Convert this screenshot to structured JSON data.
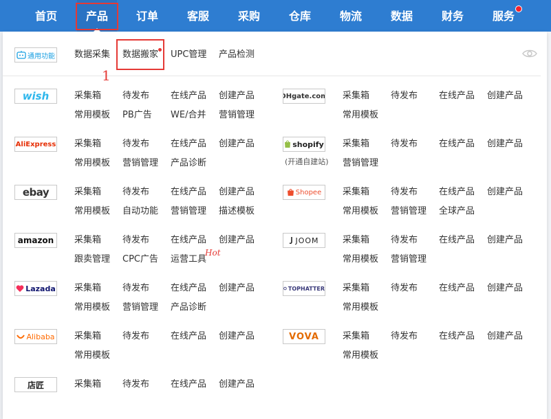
{
  "nav": {
    "items": [
      {
        "label": "首页"
      },
      {
        "label": "产品"
      },
      {
        "label": "订单"
      },
      {
        "label": "客服"
      },
      {
        "label": "采购"
      },
      {
        "label": "仓库"
      },
      {
        "label": "物流"
      },
      {
        "label": "数据"
      },
      {
        "label": "财务"
      },
      {
        "label": "服务"
      }
    ],
    "active": "产品"
  },
  "general": {
    "logo_text": "通用功能",
    "links": [
      "数据采集",
      "数据搬家",
      "UPC管理",
      "产品检测"
    ]
  },
  "annotation": {
    "number": "1"
  },
  "platforms": {
    "wish": {
      "name": "wish",
      "links": [
        "采集箱",
        "待发布",
        "在线产品",
        "创建产品",
        "常用模板",
        "PB广告",
        "WE/合并",
        "营销管理"
      ]
    },
    "dhgate": {
      "name": "DHgate.com",
      "links": [
        "采集箱",
        "待发布",
        "在线产品",
        "创建产品",
        "常用模板"
      ]
    },
    "aliexpress": {
      "name": "AliExpress",
      "links": [
        "采集箱",
        "待发布",
        "在线产品",
        "创建产品",
        "常用模板",
        "营销管理",
        "产品诊断"
      ]
    },
    "shopify": {
      "name": "shopify",
      "sub": "(开通自建站)",
      "links": [
        "采集箱",
        "待发布",
        "在线产品",
        "创建产品",
        "营销管理"
      ]
    },
    "ebay": {
      "name": "ebay",
      "links": [
        "采集箱",
        "待发布",
        "在线产品",
        "创建产品",
        "常用模板",
        "自动功能",
        "营销管理",
        "描述模板"
      ]
    },
    "shopee": {
      "name": "Shopee",
      "links": [
        "采集箱",
        "待发布",
        "在线产品",
        "创建产品",
        "常用模板",
        "营销管理",
        "全球产品"
      ]
    },
    "amazon": {
      "name": "amazon",
      "links": [
        "采集箱",
        "待发布",
        "在线产品",
        "创建产品",
        "跟卖管理",
        "CPC广告",
        "运营工具"
      ],
      "hot": "Hot"
    },
    "joom": {
      "name": "JOOM",
      "links": [
        "采集箱",
        "待发布",
        "在线产品",
        "创建产品",
        "常用模板",
        "营销管理"
      ]
    },
    "lazada": {
      "name": "Lazada",
      "links": [
        "采集箱",
        "待发布",
        "在线产品",
        "创建产品",
        "常用模板",
        "营销管理",
        "产品诊断"
      ]
    },
    "tophatter": {
      "name": "TOPHATTER",
      "links": [
        "采集箱",
        "待发布",
        "在线产品",
        "创建产品",
        "常用模板"
      ]
    },
    "alibaba": {
      "name": "Alibaba",
      "links": [
        "采集箱",
        "待发布",
        "在线产品",
        "创建产品",
        "常用模板"
      ]
    },
    "vova": {
      "name": "VOVA",
      "links": [
        "采集箱",
        "待发布",
        "在线产品",
        "创建产品",
        "常用模板"
      ]
    },
    "dianjiang": {
      "name": "店匠",
      "links": [
        "采集箱",
        "待发布",
        "在线产品",
        "创建产品"
      ]
    }
  },
  "colors": {
    "nav_bg": "#2e7dd1",
    "annotation": "#e53935",
    "link_text": "#333333"
  }
}
